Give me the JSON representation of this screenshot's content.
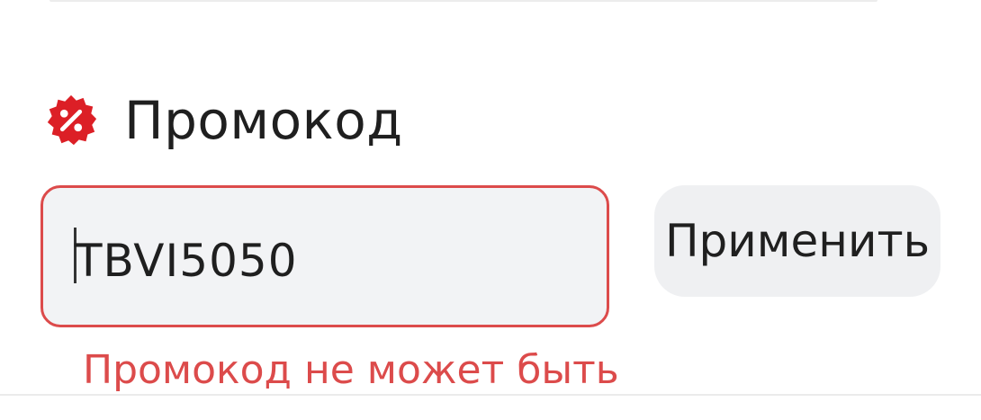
{
  "promo_section": {
    "title": "Промокод",
    "icon": "discount-badge-icon",
    "accent_color": "#dc1f26"
  },
  "promo_input": {
    "value": "TBVI5050",
    "border_color": "#dc4b4b"
  },
  "apply_button": {
    "label": "Применить"
  },
  "error": {
    "message": "Промокод не может быть",
    "color": "#dc4b4b"
  }
}
